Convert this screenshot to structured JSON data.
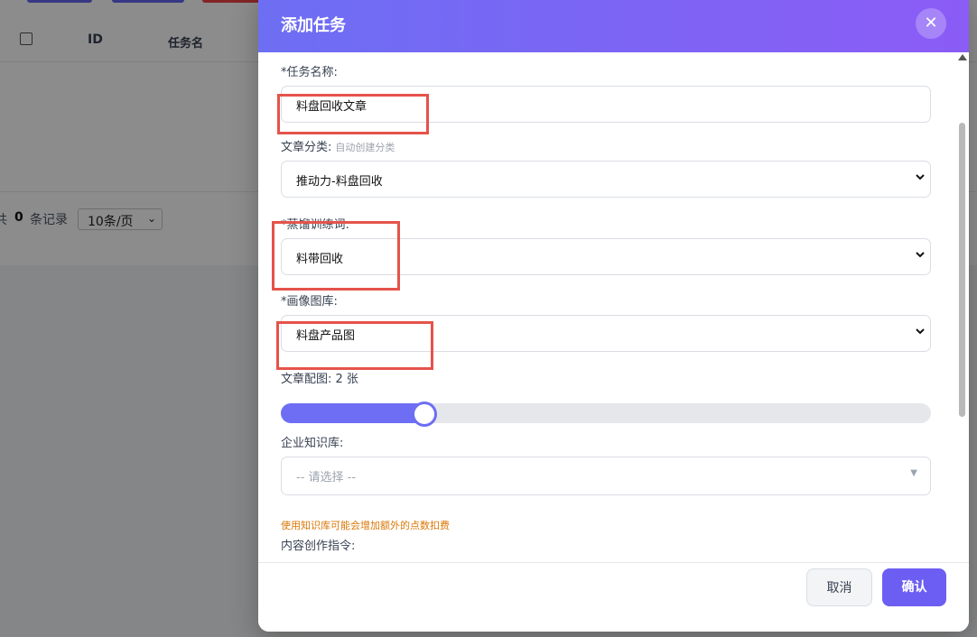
{
  "background": {
    "table_headers": [
      "ID",
      "任务名"
    ],
    "pager": {
      "prefix": "共",
      "count": "0",
      "suffix": "条记录",
      "page_size": "10条/页"
    }
  },
  "modal": {
    "title": "添加任务",
    "close_icon": "close-icon",
    "fields": {
      "task_name": {
        "label": "*任务名称:",
        "value": "料盘回收文章"
      },
      "category": {
        "label": "文章分类:",
        "hint": "自动创建分类",
        "value": "推动力-料盘回收"
      },
      "keyword": {
        "label": "*蒸馏训练词:",
        "value": "料带回收"
      },
      "gallery": {
        "label": "*画像图库:",
        "value": "料盘产品图"
      },
      "images": {
        "label": "文章配图: 2 张",
        "level": 0.22
      },
      "knowledge": {
        "label": "企业知识库:",
        "placeholder": "-- 请选择 --",
        "warning": "使用知识库可能会增加额外的点数扣费"
      },
      "instruction": {
        "label": "内容创作指令:"
      }
    },
    "buttons": {
      "cancel": "取消",
      "confirm": "确认"
    }
  },
  "colors": {
    "accent": "#6d6ef3",
    "highlight": "#e5534b",
    "warning": "#d97706"
  }
}
